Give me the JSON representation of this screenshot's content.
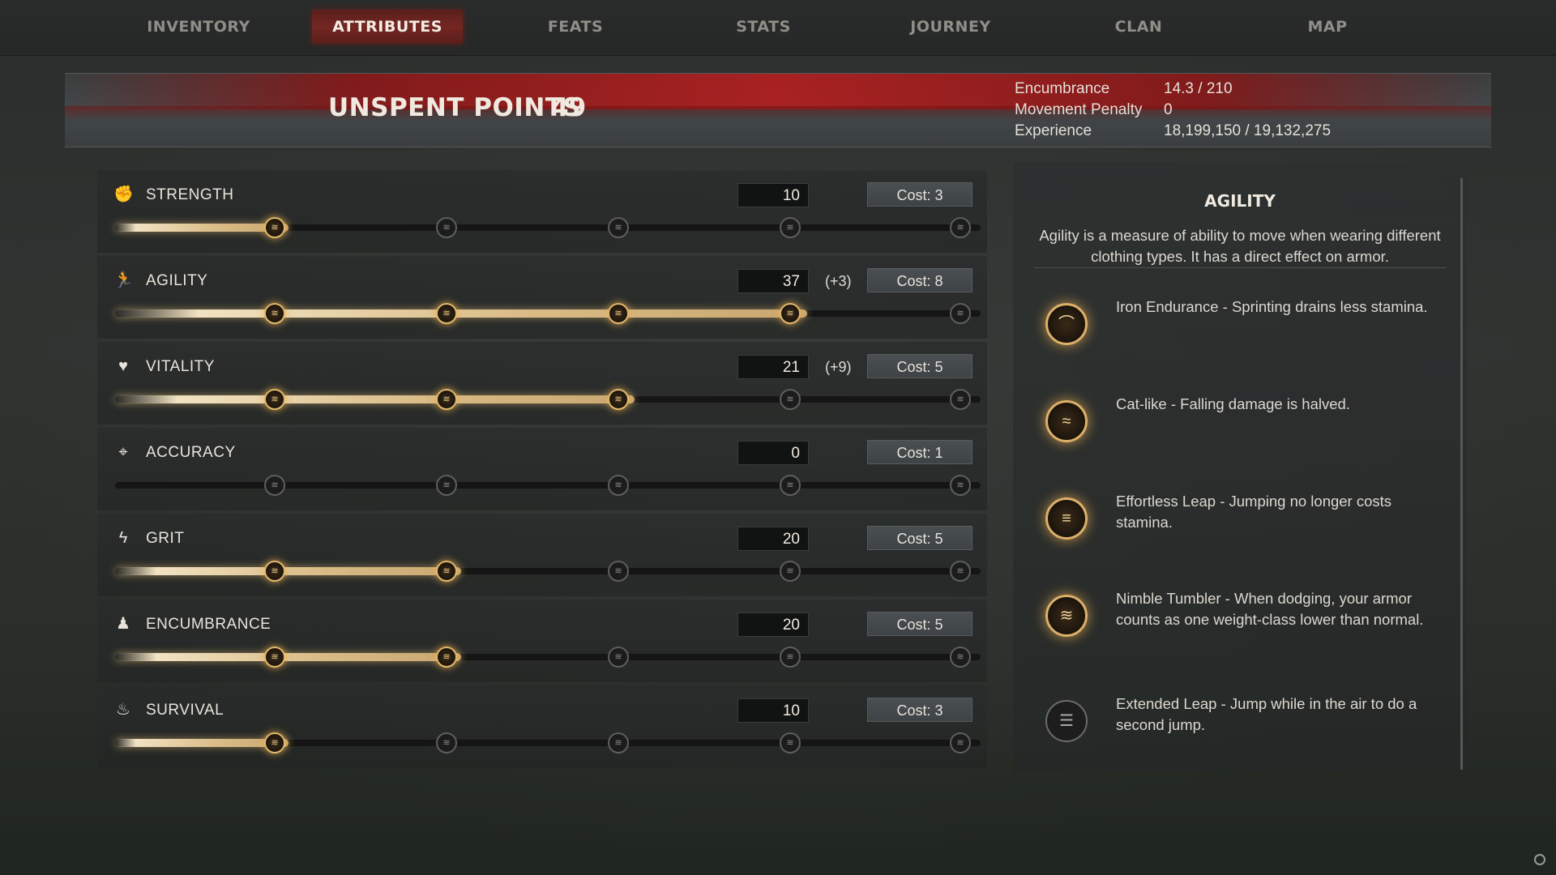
{
  "nav": {
    "tabs": [
      {
        "label": "INVENTORY",
        "active": false
      },
      {
        "label": "ATTRIBUTES",
        "active": true
      },
      {
        "label": "FEATS",
        "active": false
      },
      {
        "label": "STATS",
        "active": false
      },
      {
        "label": "JOURNEY",
        "active": false
      },
      {
        "label": "CLAN",
        "active": false
      },
      {
        "label": "MAP",
        "active": false
      }
    ]
  },
  "header": {
    "unspent_label": "UNSPENT POINTS",
    "unspent_value": "49",
    "stats": [
      {
        "label": "Encumbrance",
        "value": "14.3 / 210"
      },
      {
        "label": "Movement Penalty",
        "value": "0"
      },
      {
        "label": "Experience",
        "value": "18,199,150 / 19,132,275"
      }
    ]
  },
  "attributes": [
    {
      "name": "STRENGTH",
      "icon": "fist-icon",
      "value": "10",
      "bonus": "",
      "cost": "Cost: 3",
      "level_fraction": 0.2,
      "nodes_on": 1
    },
    {
      "name": "AGILITY",
      "icon": "running-figure-icon",
      "value": "37",
      "bonus": "(+3)",
      "cost": "Cost: 8",
      "level_fraction": 0.8,
      "nodes_on": 4
    },
    {
      "name": "VITALITY",
      "icon": "heart-icon",
      "value": "21",
      "bonus": "(+9)",
      "cost": "Cost: 5",
      "level_fraction": 0.6,
      "nodes_on": 3
    },
    {
      "name": "ACCURACY",
      "icon": "crosshair-icon",
      "value": "0",
      "bonus": "",
      "cost": "Cost: 1",
      "level_fraction": 0.0,
      "nodes_on": 0
    },
    {
      "name": "GRIT",
      "icon": "lightning-icon",
      "value": "20",
      "bonus": "",
      "cost": "Cost: 5",
      "level_fraction": 0.4,
      "nodes_on": 2
    },
    {
      "name": "ENCUMBRANCE",
      "icon": "weight-icon",
      "value": "20",
      "bonus": "",
      "cost": "Cost: 5",
      "level_fraction": 0.4,
      "nodes_on": 2
    },
    {
      "name": "SURVIVAL",
      "icon": "campfire-icon",
      "value": "10",
      "bonus": "",
      "cost": "Cost: 3",
      "level_fraction": 0.2,
      "nodes_on": 1
    }
  ],
  "description": {
    "title": "AGILITY",
    "text": "Agility  is a measure of ability to move when wearing different clothing types. It has a direct effect on armor.",
    "perks": [
      {
        "text": "Iron Endurance - Sprinting drains less stamina.",
        "unlocked": true,
        "icon": "iron-endurance-icon"
      },
      {
        "text": "Cat-like - Falling damage is halved.",
        "unlocked": true,
        "icon": "cat-like-icon"
      },
      {
        "text": "Effortless Leap - Jumping no longer costs stamina.",
        "unlocked": true,
        "icon": "effortless-leap-icon"
      },
      {
        "text": "Nimble Tumbler - When dodging, your armor counts as one weight-class lower than normal.",
        "unlocked": true,
        "icon": "nimble-tumbler-icon"
      },
      {
        "text": "Extended Leap - Jump while in the air to do a second jump.",
        "unlocked": false,
        "icon": "extended-leap-icon"
      }
    ]
  },
  "colors": {
    "accent_red": "#742622",
    "gold": "#e2b86a"
  }
}
